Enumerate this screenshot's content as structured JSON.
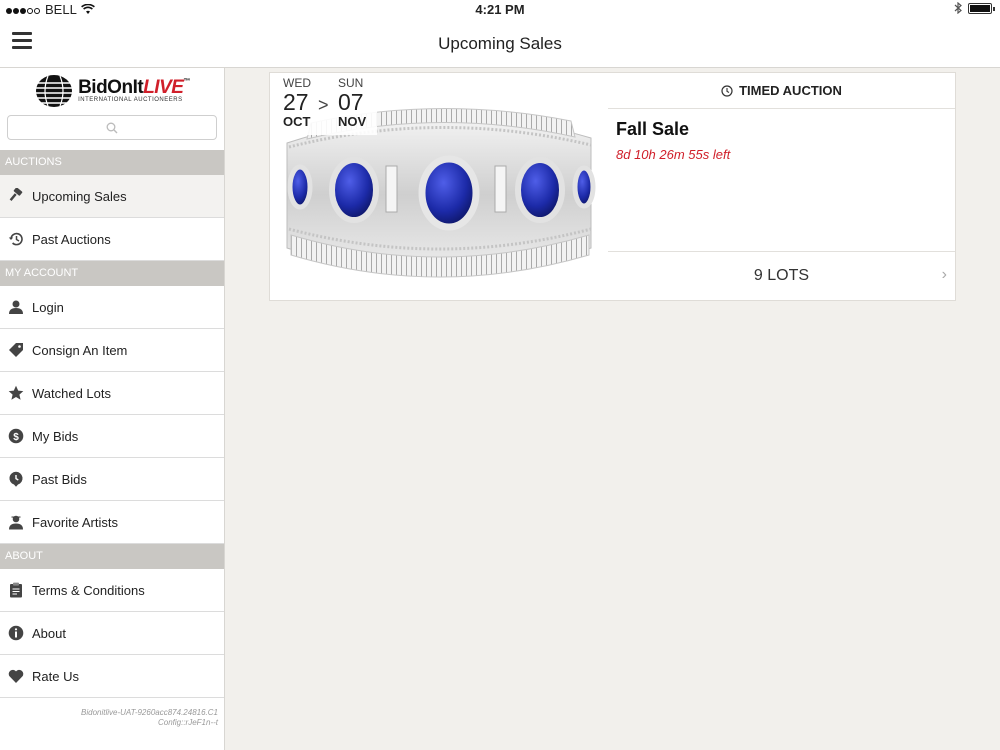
{
  "status": {
    "carrier": "BELL",
    "time": "4:21 PM"
  },
  "header": {
    "title": "Upcoming Sales"
  },
  "sidebar": {
    "logo": {
      "brand_a": "BidOnIt",
      "brand_b": "LIVE",
      "tm": "™",
      "tagline": "INTERNATIONAL AUCTIONEERS"
    },
    "search": {
      "placeholder": ""
    },
    "sections": {
      "auctions": "AUCTIONS",
      "my_account": "MY ACCOUNT",
      "about": "ABOUT"
    },
    "items": {
      "upcoming_sales": "Upcoming Sales",
      "past_auctions": "Past Auctions",
      "login": "Login",
      "consign": "Consign An Item",
      "watched": "Watched Lots",
      "my_bids": "My Bids",
      "past_bids": "Past Bids",
      "favorite_artists": "Favorite Artists",
      "terms": "Terms & Conditions",
      "about": "About",
      "rate_us": "Rate Us"
    },
    "version_line1": "Bidonitlive-UAT-9260acc874.24816.C1",
    "version_line2": "Config::rJeF1n--t"
  },
  "sale": {
    "start": {
      "dow": "WED",
      "day": "27",
      "month": "OCT"
    },
    "separator": ">",
    "end": {
      "dow": "SUN",
      "day": "07",
      "month": "NOV"
    },
    "type": "TIMED AUCTION",
    "title": "Fall Sale",
    "time_left": "8d 10h 26m 55s left",
    "lots": "9 LOTS"
  },
  "colors": {
    "accent_red": "#d01f2a",
    "sapphire": "#1c2aa8",
    "section_bg": "#c9c7c3",
    "page_bg": "#f2f0ec"
  }
}
